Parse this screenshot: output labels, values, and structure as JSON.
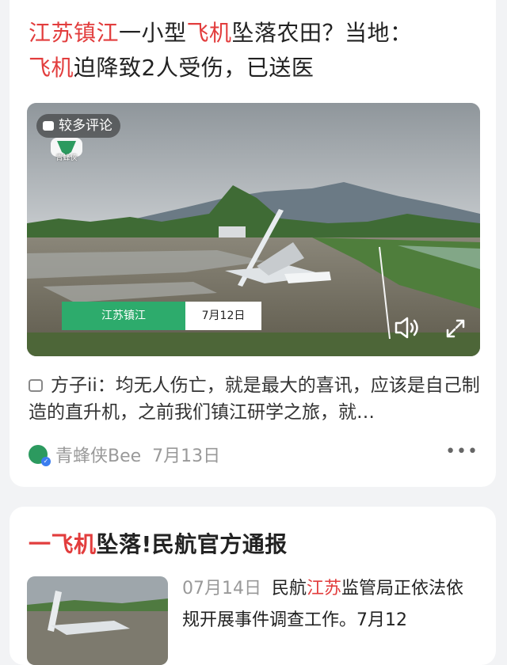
{
  "article1": {
    "title_parts": [
      "江苏镇江",
      "一小型",
      "飞机",
      "坠落农田？当地：",
      "飞机",
      "迫降致2人受伤，已送医"
    ],
    "video": {
      "badge": "较多评论",
      "logo_text": "青蜂侠",
      "location": "江苏镇江",
      "date": "7月12日",
      "sound_icon": "sound-icon",
      "fullscreen_icon": "expand-icon"
    },
    "comment": {
      "author": "方子ii：",
      "text": "均无人伤亡，就是最大的喜讯，应该是自己制造的直升机，之前我们镇江研学之旅，就…"
    },
    "source": "青蜂侠Bee",
    "date": "7月13日",
    "more": "•••"
  },
  "article2": {
    "title_parts": [
      "一",
      "飞机",
      "坠落!民航官方通报"
    ],
    "date": "07月14日",
    "snippet_parts": [
      "民航",
      "江苏",
      "监管局正依法依规开展事件调查工作。7月12"
    ]
  },
  "colors": {
    "highlight": "#e23d3d",
    "green": "#2dab6c"
  }
}
